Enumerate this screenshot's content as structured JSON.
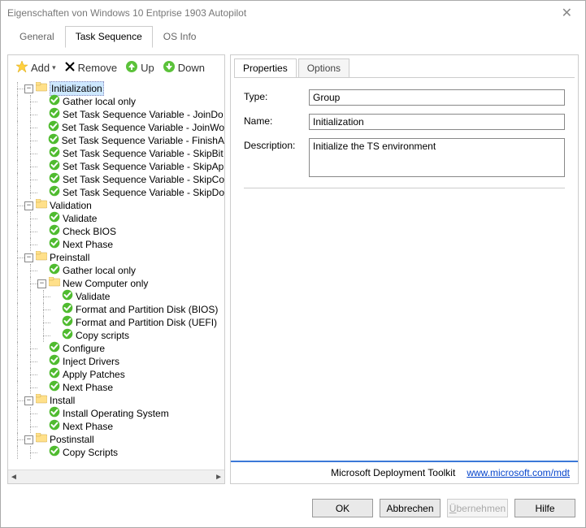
{
  "window": {
    "title": "Eigenschaften von Windows 10 Entprise 1903 Autopilot"
  },
  "topTabs": {
    "general": "General",
    "taskSequence": "Task Sequence",
    "osInfo": "OS Info",
    "active": "taskSequence"
  },
  "toolbar": {
    "add": "Add",
    "remove": "Remove",
    "up": "Up",
    "down": "Down"
  },
  "tree": {
    "nodes": [
      {
        "depth": 0,
        "exp": "-",
        "type": "folder",
        "label": "Initialization",
        "selected": true
      },
      {
        "depth": 1,
        "exp": "",
        "type": "step",
        "label": "Gather local only"
      },
      {
        "depth": 1,
        "exp": "",
        "type": "step",
        "label": "Set Task Sequence Variable - JoinDo"
      },
      {
        "depth": 1,
        "exp": "",
        "type": "step",
        "label": "Set Task Sequence Variable - JoinWo"
      },
      {
        "depth": 1,
        "exp": "",
        "type": "step",
        "label": "Set Task Sequence Variable - FinishA"
      },
      {
        "depth": 1,
        "exp": "",
        "type": "step",
        "label": "Set Task Sequence Variable - SkipBit"
      },
      {
        "depth": 1,
        "exp": "",
        "type": "step",
        "label": "Set Task Sequence Variable - SkipAp"
      },
      {
        "depth": 1,
        "exp": "",
        "type": "step",
        "label": "Set Task Sequence Variable - SkipCo"
      },
      {
        "depth": 1,
        "exp": "",
        "type": "step",
        "label": "Set Task Sequence Variable - SkipDo"
      },
      {
        "depth": 0,
        "exp": "-",
        "type": "folder",
        "label": "Validation"
      },
      {
        "depth": 1,
        "exp": "",
        "type": "step",
        "label": "Validate"
      },
      {
        "depth": 1,
        "exp": "",
        "type": "step",
        "label": "Check BIOS"
      },
      {
        "depth": 1,
        "exp": "",
        "type": "step",
        "label": "Next Phase"
      },
      {
        "depth": 0,
        "exp": "-",
        "type": "folder",
        "label": "Preinstall"
      },
      {
        "depth": 1,
        "exp": "",
        "type": "step",
        "label": "Gather local only"
      },
      {
        "depth": 1,
        "exp": "-",
        "type": "folder",
        "label": "New Computer only"
      },
      {
        "depth": 2,
        "exp": "",
        "type": "step",
        "label": "Validate"
      },
      {
        "depth": 2,
        "exp": "",
        "type": "step",
        "label": "Format and Partition Disk (BIOS)"
      },
      {
        "depth": 2,
        "exp": "",
        "type": "step",
        "label": "Format and Partition Disk (UEFI)"
      },
      {
        "depth": 2,
        "exp": "",
        "type": "step",
        "label": "Copy scripts"
      },
      {
        "depth": 1,
        "exp": "",
        "type": "step",
        "label": "Configure"
      },
      {
        "depth": 1,
        "exp": "",
        "type": "step",
        "label": "Inject Drivers"
      },
      {
        "depth": 1,
        "exp": "",
        "type": "step",
        "label": "Apply Patches"
      },
      {
        "depth": 1,
        "exp": "",
        "type": "step",
        "label": "Next Phase"
      },
      {
        "depth": 0,
        "exp": "-",
        "type": "folder",
        "label": "Install"
      },
      {
        "depth": 1,
        "exp": "",
        "type": "step",
        "label": "Install Operating System"
      },
      {
        "depth": 1,
        "exp": "",
        "type": "step",
        "label": "Next Phase"
      },
      {
        "depth": 0,
        "exp": "-",
        "type": "folder",
        "label": "Postinstall"
      },
      {
        "depth": 1,
        "exp": "",
        "type": "step",
        "label": "Copy Scripts"
      }
    ]
  },
  "propTabs": {
    "properties": "Properties",
    "options": "Options",
    "active": "properties"
  },
  "form": {
    "typeLabel": "Type:",
    "typeValue": "Group",
    "nameLabel": "Name:",
    "nameValue": "Initialization",
    "descLabel": "Description:",
    "descValue": "Initialize the TS environment"
  },
  "footer": {
    "text": "Microsoft Deployment Toolkit",
    "linkText": "www.microsoft.com/mdt",
    "href": "http://www.microsoft.com/mdt"
  },
  "buttons": {
    "ok": "OK",
    "cancel": "Abbrechen",
    "apply": "Übernehmen",
    "help": "Hilfe"
  },
  "icons": {
    "add": "star-add-icon",
    "remove": "x-icon",
    "up": "arrow-up-icon",
    "down": "arrow-down-icon",
    "folder": "folder-icon",
    "step": "check-icon"
  }
}
